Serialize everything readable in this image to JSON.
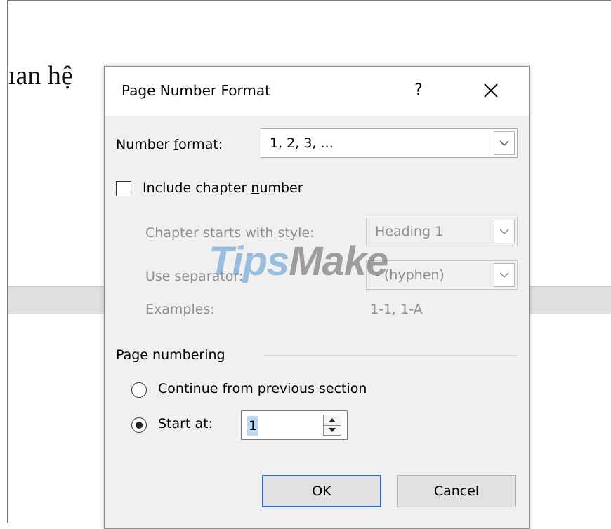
{
  "background_doc": {
    "text": "ıan hệ"
  },
  "dialog": {
    "title": "Page Number Format",
    "help_label": "?",
    "close_label": "✕",
    "number_format": {
      "label_pre": "Number ",
      "label_u": "f",
      "label_post": "ormat:",
      "value": "1, 2, 3, ..."
    },
    "include_chapter": {
      "label_pre": "Include chapter ",
      "label_u": "n",
      "label_post": "umber",
      "checked": false
    },
    "chapter_style": {
      "label": "Chapter starts with style:",
      "value": "Heading 1"
    },
    "separator": {
      "label": "Use separator:",
      "value": "- (hyphen)"
    },
    "examples": {
      "label": "Examples:",
      "value": "1-1, 1-A"
    },
    "page_numbering": {
      "group_label": "Page numbering",
      "continue": {
        "label_u": "C",
        "label_post": "ontinue from previous section",
        "selected": false
      },
      "start_at": {
        "label_pre": "Start ",
        "label_u": "a",
        "label_post": "t:",
        "selected": true,
        "value": "1"
      }
    },
    "ok_label": "OK",
    "cancel_label": "Cancel"
  },
  "watermark": {
    "part1": "Tips",
    "part2": "Make"
  },
  "colors": {
    "dialog_bg": "#f0f0f0",
    "ok_border": "#2f6fc1",
    "selection": "#bcd7f2",
    "disabled_text": "#8f8f8f"
  }
}
